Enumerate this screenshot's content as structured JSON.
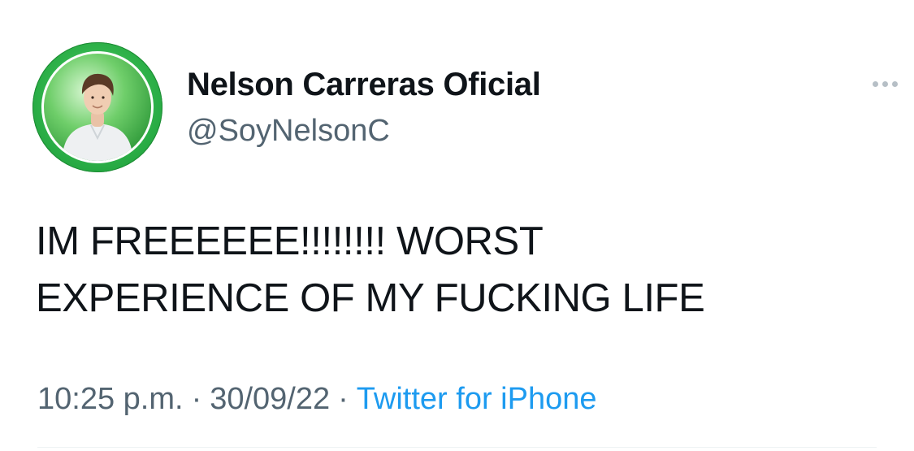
{
  "tweet": {
    "author": {
      "display_name": "Nelson Carreras Oficial",
      "handle": "@SoyNelsonC"
    },
    "more_icon": "more-horizontal-icon",
    "text_line1": "IM FREEEEEE!!!!!!!! WORST",
    "text_line2": "EXPERIENCE OF MY FUCKING LIFE",
    "meta": {
      "time": "10:25 p.m.",
      "separator": "·",
      "date": "30/09/22",
      "source": "Twitter for iPhone"
    },
    "colors": {
      "text": "#0f1419",
      "secondary": "#536471",
      "link": "#1d9bf0",
      "avatar_ring": "#2fb24a"
    }
  }
}
